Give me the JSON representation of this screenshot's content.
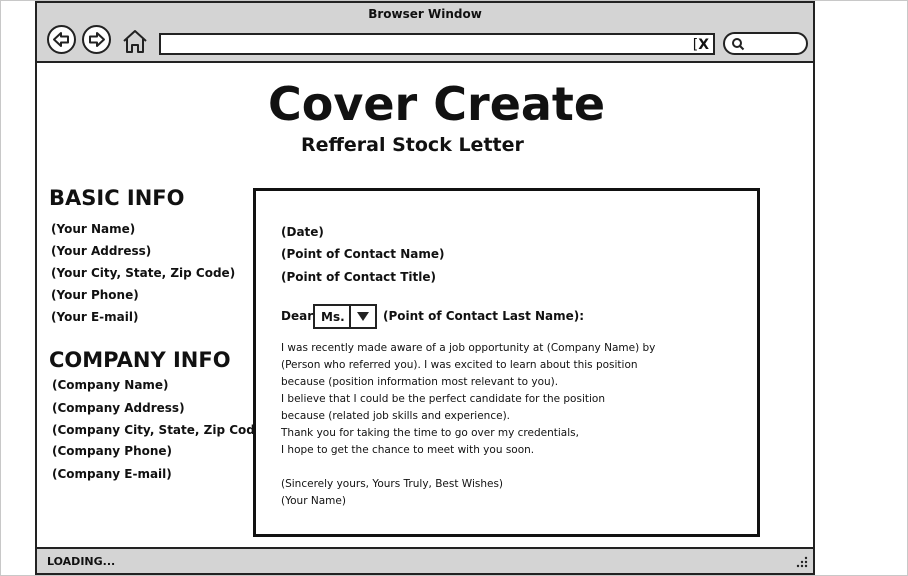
{
  "window": {
    "title": "Browser Window",
    "clear_symbol": "X",
    "status": "LOADING..."
  },
  "app": {
    "title": "Cover Create",
    "subtitle": "Refferal Stock Letter"
  },
  "basic_info": {
    "heading": "BASIC INFO",
    "items": [
      "(Your Name)",
      "(Your Address)",
      "(Your City, State, Zip Code)",
      "(Your Phone)",
      "(Your E-mail)"
    ]
  },
  "company_info": {
    "heading": "COMPANY INFO",
    "items": [
      "(Company Name)",
      "(Company Address)",
      "(Company City, State, Zip Code)",
      "(Company Phone)",
      "(Company E-mail)"
    ]
  },
  "letter": {
    "date": "(Date)",
    "contact_name": "(Point of Contact Name)",
    "contact_title": "(Point of Contact Title)",
    "dear_label": "Dear",
    "salutation_value": "Ms.",
    "dear_contact": "(Point of Contact Last Name):",
    "body_lines": [
      "I was recently made aware of a job opportunity at (Company Name) by",
      "(Person who referred you). I was excited to learn about this position",
      "because (position information most relevant to you).",
      "I believe that I could be the perfect candidate for the position",
      "because (related job skills and experience).",
      "Thank you for taking the time to go over my credentials,",
      "I hope to get the chance to meet with you soon."
    ],
    "closing": "(Sincerely yours, Yours Truly, Best Wishes)",
    "signature": "(Your Name)"
  },
  "icons": {
    "back": "back-arrow-icon",
    "forward": "forward-arrow-icon",
    "home": "home-icon",
    "search": "search-icon",
    "dropdown": "chevron-down-icon",
    "grip": "resize-grip-icon"
  }
}
